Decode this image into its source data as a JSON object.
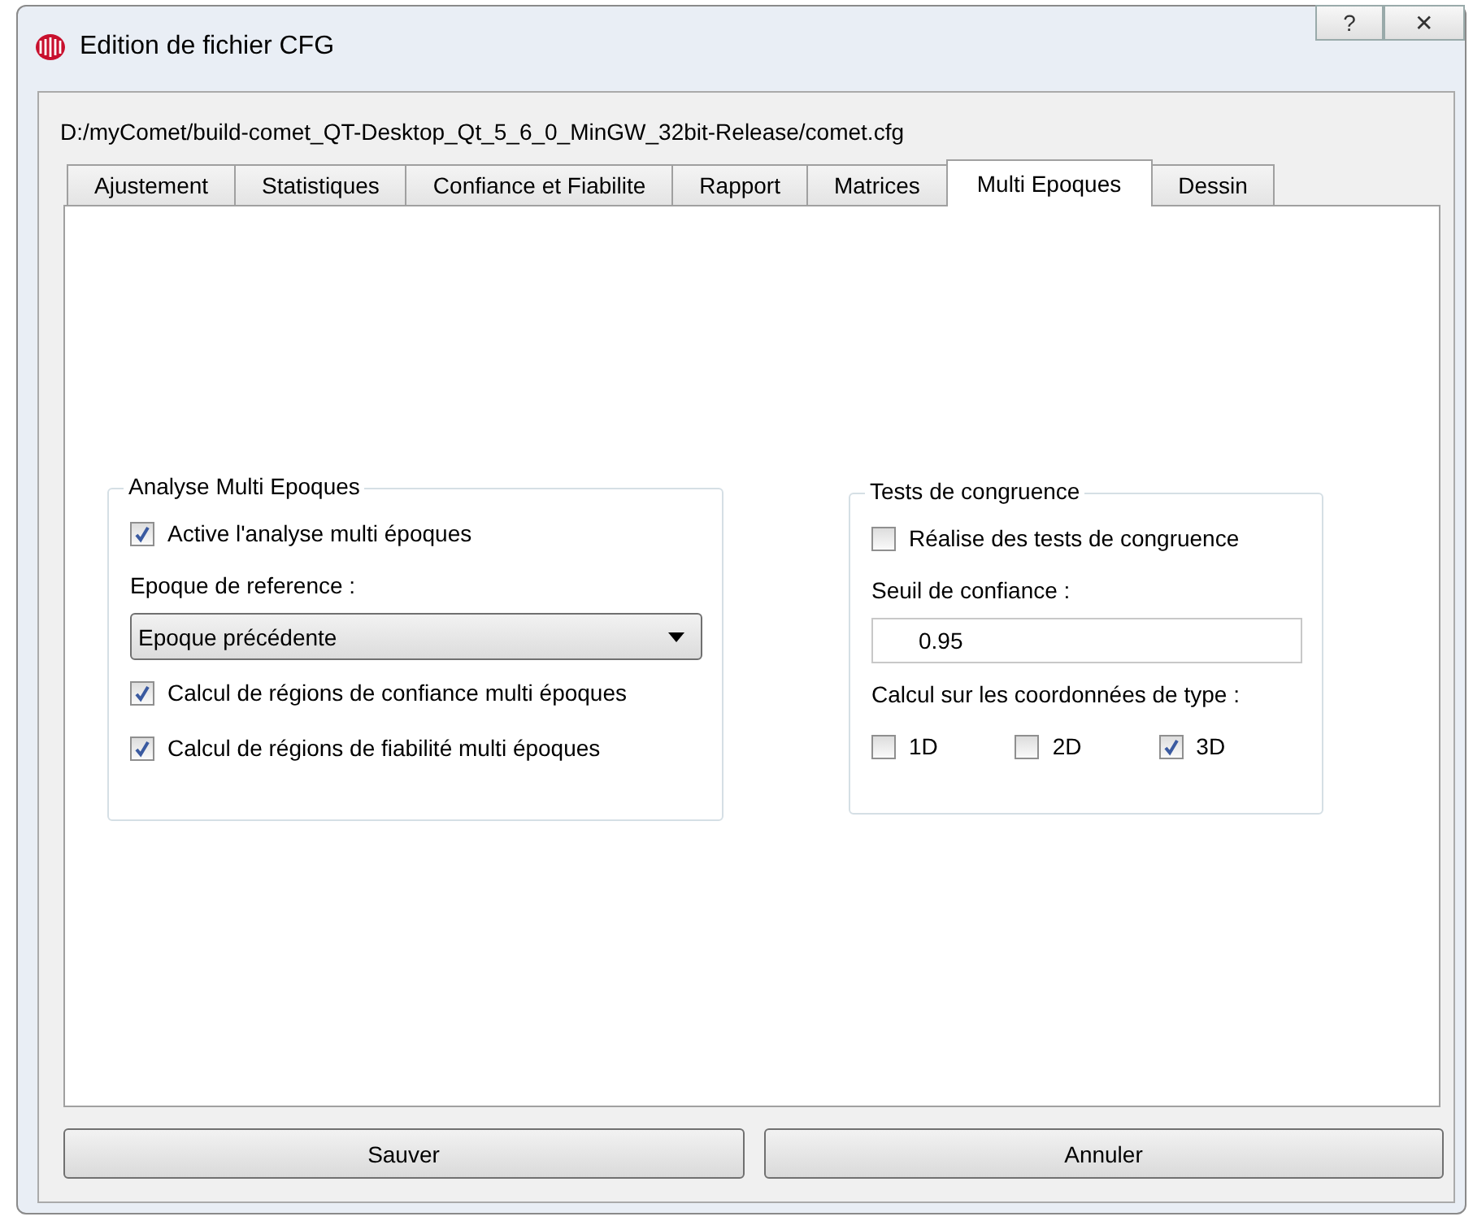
{
  "window": {
    "title": "Edition de fichier CFG",
    "help": "?",
    "close": "✕"
  },
  "path": "D:/myComet/build-comet_QT-Desktop_Qt_5_6_0_MinGW_32bit-Release/comet.cfg",
  "tabs": [
    {
      "label": "Ajustement",
      "selected": false
    },
    {
      "label": "Statistiques",
      "selected": false
    },
    {
      "label": "Confiance et Fiabilite",
      "selected": false
    },
    {
      "label": "Rapport",
      "selected": false
    },
    {
      "label": "Matrices",
      "selected": false
    },
    {
      "label": "Multi Epoques",
      "selected": true
    },
    {
      "label": "Dessin",
      "selected": false
    }
  ],
  "groups": [
    {
      "title": "Analyse Multi Epoques",
      "items": [
        {
          "kind": "checkbox",
          "label": "Active l'analyse multi époques",
          "checked": true
        },
        {
          "kind": "label",
          "label": "Epoque de reference :"
        },
        {
          "kind": "combo",
          "value": "Epoque précédente"
        },
        {
          "kind": "checkbox",
          "label": "Calcul de régions de confiance multi époques",
          "checked": true
        },
        {
          "kind": "checkbox",
          "label": "Calcul de régions de fiabilité multi époques",
          "checked": true
        }
      ]
    },
    {
      "title": "Tests de congruence",
      "items": [
        {
          "kind": "checkbox",
          "label": "Réalise des tests de congruence",
          "checked": false
        },
        {
          "kind": "label",
          "label": "Seuil de confiance :"
        },
        {
          "kind": "input",
          "value": "0.95"
        },
        {
          "kind": "label",
          "label": "Calcul sur les coordonnées de type :"
        },
        {
          "kind": "checkrow",
          "options": [
            {
              "label": "1D",
              "checked": false
            },
            {
              "label": "2D",
              "checked": false
            },
            {
              "label": "3D",
              "checked": true
            }
          ]
        }
      ]
    }
  ],
  "buttons": [
    "Sauver",
    "Annuler"
  ]
}
